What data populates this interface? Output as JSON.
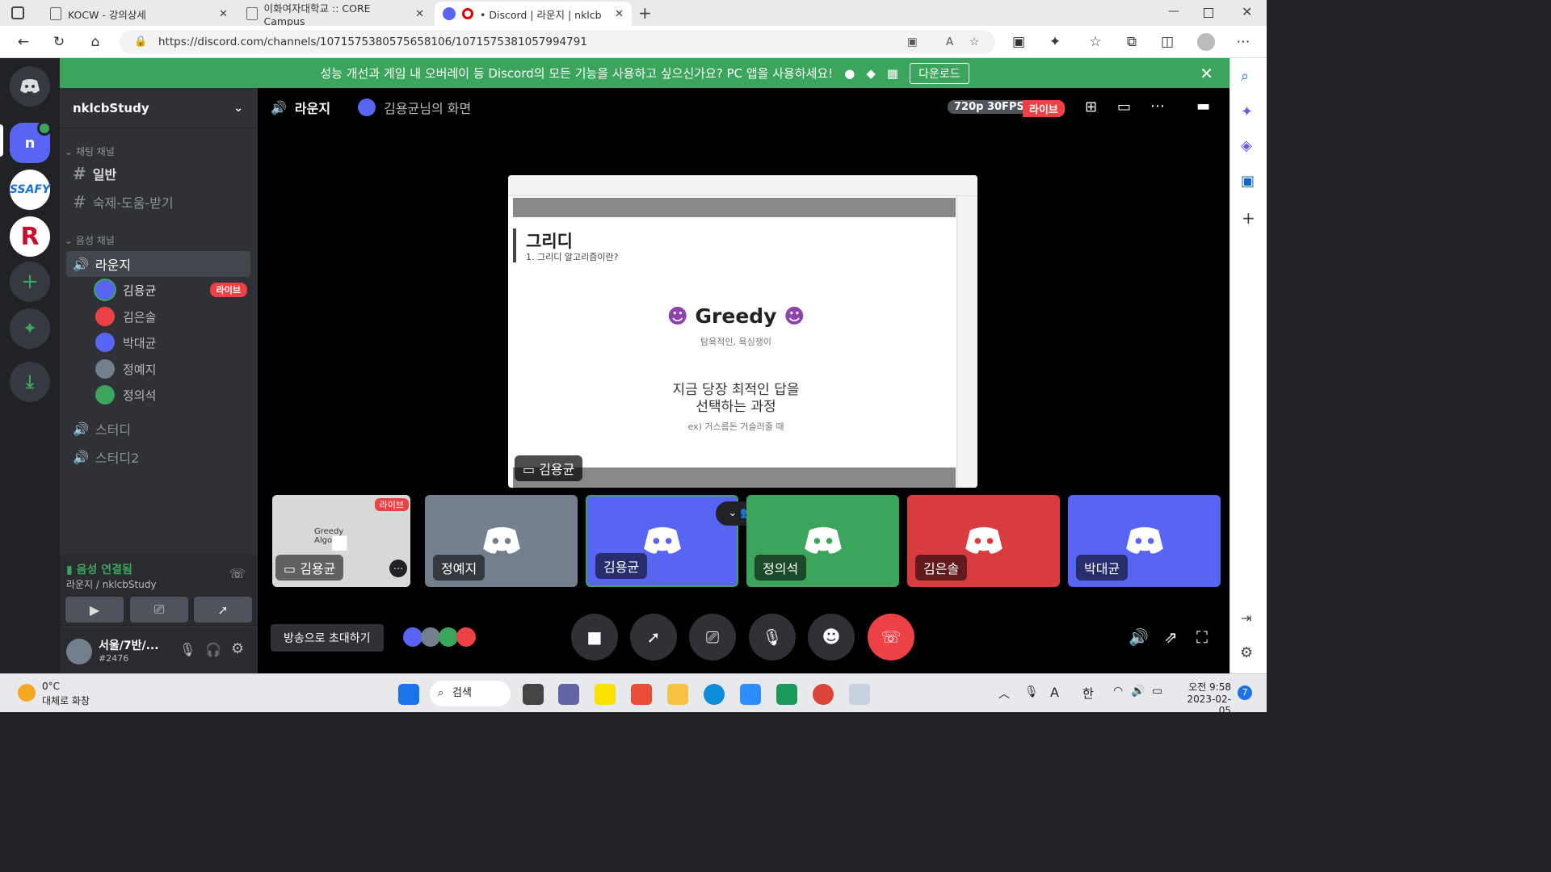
{
  "browser": {
    "tabs": [
      {
        "title": "KOCW - 강의상세"
      },
      {
        "title": "이화여자대학교 :: CORE Campus"
      },
      {
        "title": "• Discord | 라운지 | nklcbStu"
      }
    ],
    "url": "https://discord.com/channels/1071575380575658106/1071575381057994791"
  },
  "banner": {
    "text": "성능 개선과 게임 내 오버레이 등 Discord의 모든 기능을 사용하고 싶으신가요? PC 앱을 사용하세요!",
    "download_label": "다운로드"
  },
  "server": {
    "name": "nklcbStudy",
    "server_icon_letter": "n",
    "text_category": "채팅 채널",
    "text_channels": [
      "일반",
      "숙제-도움-받기"
    ],
    "voice_category": "음성 채널",
    "voice_channels": [
      "라운지",
      "스터디",
      "스터디2"
    ],
    "voice_users": [
      {
        "name": "김용균",
        "live": "라이브",
        "color": "#5865f2"
      },
      {
        "name": "김은솔",
        "color": "#ed4245"
      },
      {
        "name": "박대균",
        "color": "#5865f2"
      },
      {
        "name": "정예지",
        "color": "#747f8d"
      },
      {
        "name": "정의석",
        "color": "#3ba55c"
      }
    ]
  },
  "voice_status": {
    "title": "음성 연결됨",
    "subtitle": "라운지 / nklcbStudy"
  },
  "user": {
    "name": "서울/7반/...",
    "tag": "#2476"
  },
  "stage": {
    "channel": "라운지",
    "stream_title": "김용균님의 화면",
    "quality": "720p 30FPS",
    "live": "라이브",
    "presenter_tag": "김용균",
    "invite_label": "방송으로 초대하기"
  },
  "slide": {
    "heading": "그리디",
    "sub": "1. 그리디 알고리즘이란?",
    "title": "Greedy",
    "subtitle": "탐욕적인, 욕심쟁이",
    "line1": "지금 당장 최적인 답을",
    "line2": "선택하는 과정",
    "example": "ex) 거스름돈 거슬러줄 때"
  },
  "tiles": [
    {
      "name": "김용균",
      "color": "#444",
      "badge": "라이브",
      "thumb_text": "Greedy\nAlgo"
    },
    {
      "name": "정예지",
      "color": "#747f8d"
    },
    {
      "name": "김용균",
      "color": "#5865f2"
    },
    {
      "name": "정의석",
      "color": "#3ba55c"
    },
    {
      "name": "김은솔",
      "color": "#d83c3e"
    },
    {
      "name": "박대균",
      "color": "#5865f2"
    }
  ],
  "taskbar": {
    "weather_temp": "0°C",
    "weather_desc": "대체로 화창",
    "search": "검색",
    "time": "오전 9:58",
    "date": "2023-02-05",
    "lang": "한",
    "notif": "7"
  }
}
